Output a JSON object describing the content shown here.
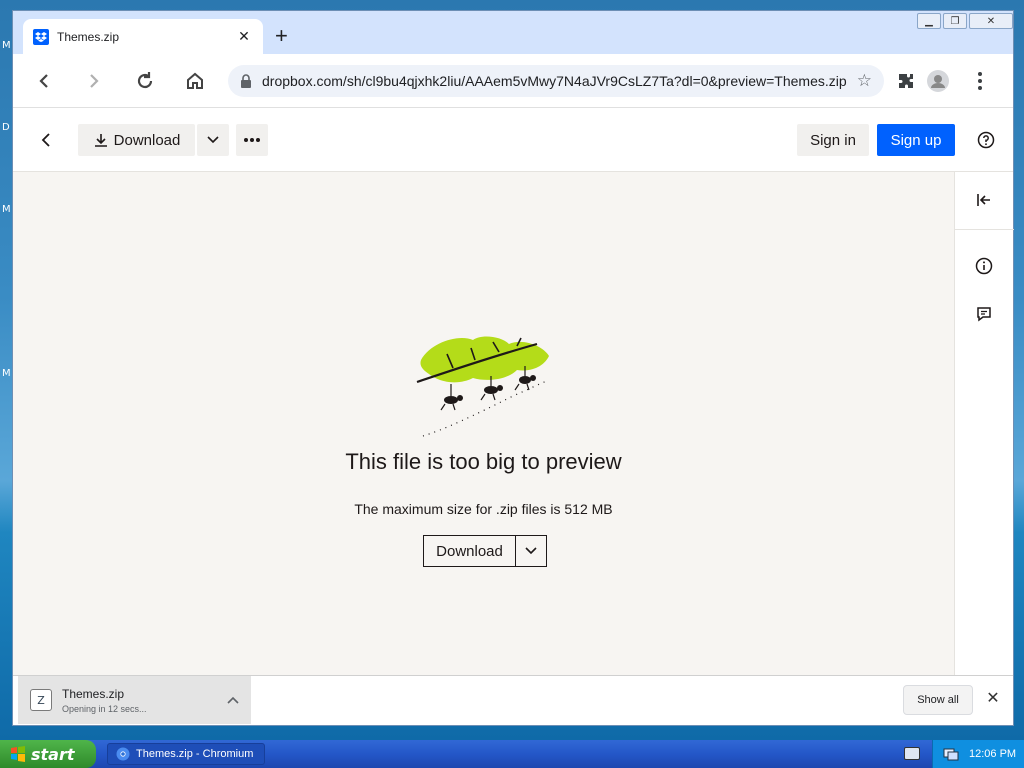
{
  "browser": {
    "tab_title": "Themes.zip",
    "url": "dropbox.com/sh/cl9bu4qjxhk2liu/AAAem5vMwy7N4aJVr9CsLZ7Ta?dl=0&preview=Themes.zip",
    "window_controls": [
      "minimize",
      "restore",
      "close"
    ]
  },
  "header": {
    "download_label": "Download",
    "sign_in_label": "Sign in",
    "sign_up_label": "Sign up"
  },
  "preview": {
    "title": "This file is too big to preview",
    "subtitle": "The maximum size for .zip files is 512 MB",
    "download_label": "Download"
  },
  "download_shelf": {
    "file_name": "Themes.zip",
    "status": "Opening in 12 secs...",
    "show_all_label": "Show all"
  },
  "taskbar": {
    "start_label": "start",
    "task_label": "Themes.zip - Chromium",
    "clock": "12:06 PM"
  },
  "colors": {
    "accent_blue": "#0061fe",
    "preview_bg": "#f7f5f2",
    "leaf_green": "#b4dc19"
  }
}
